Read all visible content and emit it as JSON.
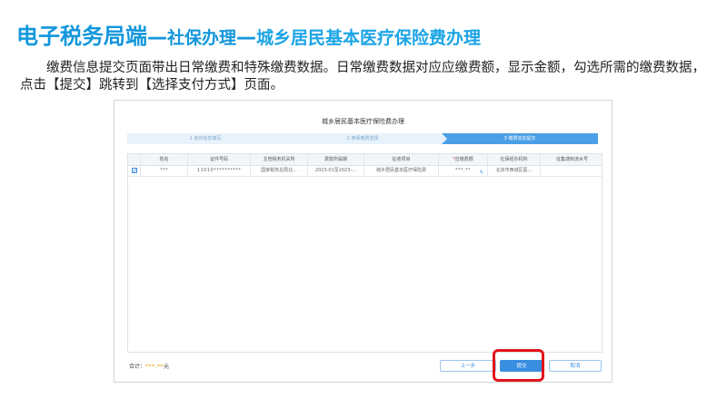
{
  "slide": {
    "title_main": "电子税务局端",
    "title_dash1": "—",
    "title_sub1": "社保办理",
    "title_dash2": "—",
    "title_sub2": "城乡居民基本医疗保险费办理",
    "description": "缴费信息提交页面带出日常缴费和特殊缴费数据。日常缴费数据对应应缴费额，显示金额，勾选所需的缴费数据，点击【提交】跳转到【选择支付方式】页面。"
  },
  "form": {
    "title": "城乡居民基本医疗保险费办理",
    "steps": [
      "1 身份信息填写",
      "2 参保缴费选择",
      "3 缴费信息提交"
    ],
    "active_step": 3,
    "columns": [
      "姓名",
      "证件号码",
      "主管税务机关所",
      "费款所属期",
      "征收项目",
      "*应缴费额",
      "社保经办机构",
      "征集通知流水号"
    ],
    "rows": [
      {
        "checked": true,
        "name": "***",
        "id_number": "11010**********",
        "tax_office": "国家税务总局北...",
        "period": "2023-01至2023-...",
        "item": "城乡居民基本医疗保险费",
        "amount": "***.**",
        "agency": "北京市西城区医...",
        "serial": ""
      }
    ],
    "total_label": "合计：",
    "total_amount": "***.**",
    "total_unit": "元",
    "buttons": {
      "prev": "上一步",
      "submit": "提交",
      "cancel": "取消"
    }
  },
  "colors": {
    "title": "#1296db",
    "accent": "#3a8ee0",
    "highlight": "#e2141a"
  }
}
